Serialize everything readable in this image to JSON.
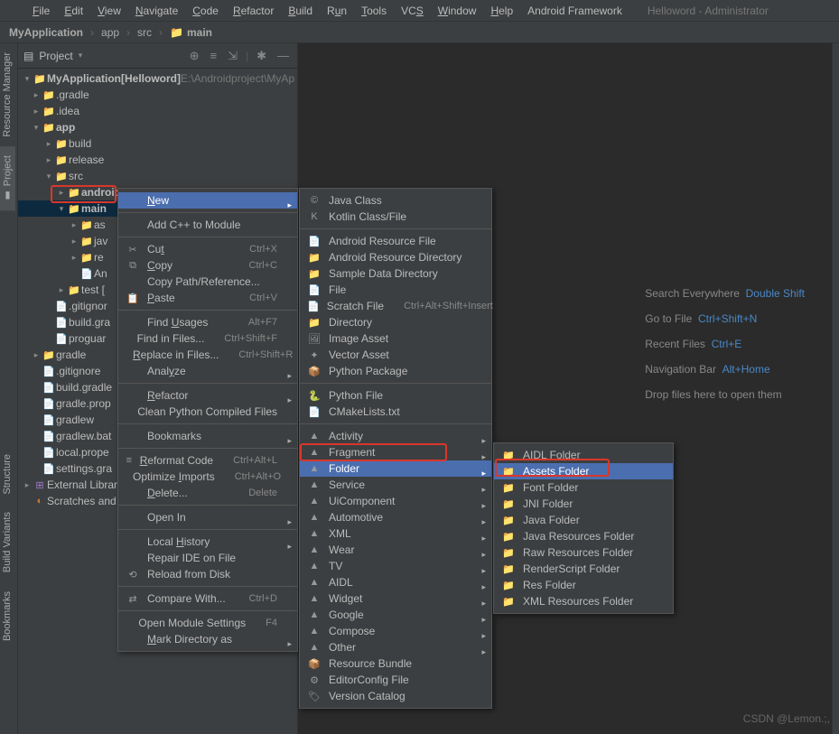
{
  "menubar": {
    "items": [
      "File",
      "Edit",
      "View",
      "Navigate",
      "Code",
      "Refactor",
      "Build",
      "Run",
      "Tools",
      "VCS",
      "Window",
      "Help",
      "Android Framework"
    ],
    "title": "Helloword - Administrator"
  },
  "crumb": [
    "MyApplication",
    "app",
    "src",
    "main"
  ],
  "leftTabs": [
    "Resource Manager",
    "Project"
  ],
  "bottomTabs": [
    "Structure",
    "Build Variants",
    "Bookmarks"
  ],
  "sidebar": {
    "title": "Project",
    "tree": [
      {
        "d": 0,
        "a": "v",
        "ic": "📁",
        "cls": "c-blue",
        "t": "MyApplication",
        "b": true,
        "extra": "[Helloword]",
        "hint": "E:\\Androidproject\\MyAp"
      },
      {
        "d": 1,
        "a": ">",
        "ic": "📁",
        "cls": "c-orange",
        "t": ".gradle"
      },
      {
        "d": 1,
        "a": ">",
        "ic": "📁",
        "cls": "c-grey",
        "t": ".idea"
      },
      {
        "d": 1,
        "a": "v",
        "ic": "📁",
        "cls": "c-teal",
        "t": "app",
        "b": true
      },
      {
        "d": 2,
        "a": ">",
        "ic": "📁",
        "cls": "c-orange",
        "t": "build"
      },
      {
        "d": 2,
        "a": ">",
        "ic": "📁",
        "cls": "c-grey",
        "t": "release"
      },
      {
        "d": 2,
        "a": "v",
        "ic": "📁",
        "cls": "c-grey",
        "t": "src"
      },
      {
        "d": 3,
        "a": ">",
        "ic": "📁",
        "cls": "c-teal",
        "t": "androidTest",
        "b": true
      },
      {
        "d": 3,
        "a": "v",
        "ic": "📁",
        "cls": "c-teal",
        "t": "main",
        "b": true,
        "sel": true
      },
      {
        "d": 4,
        "a": ">",
        "ic": "📁",
        "cls": "c-orange",
        "t": "as"
      },
      {
        "d": 4,
        "a": ">",
        "ic": "📁",
        "cls": "c-blue",
        "t": "jav"
      },
      {
        "d": 4,
        "a": ">",
        "ic": "📁",
        "cls": "c-orange",
        "t": "re"
      },
      {
        "d": 4,
        "a": "",
        "ic": "📄",
        "cls": "c-grey",
        "t": "An"
      },
      {
        "d": 3,
        "a": ">",
        "ic": "📁",
        "cls": "c-teal",
        "t": "test ["
      },
      {
        "d": 2,
        "a": "",
        "ic": "📄",
        "cls": "c-grey",
        "t": ".gitignor"
      },
      {
        "d": 2,
        "a": "",
        "ic": "📄",
        "cls": "c-teal",
        "t": "build.gra"
      },
      {
        "d": 2,
        "a": "",
        "ic": "📄",
        "cls": "c-grey",
        "t": "proguar"
      },
      {
        "d": 1,
        "a": ">",
        "ic": "📁",
        "cls": "c-grey",
        "t": "gradle"
      },
      {
        "d": 1,
        "a": "",
        "ic": "📄",
        "cls": "c-grey",
        "t": ".gitignore"
      },
      {
        "d": 1,
        "a": "",
        "ic": "📄",
        "cls": "c-teal",
        "t": "build.gradle"
      },
      {
        "d": 1,
        "a": "",
        "ic": "📄",
        "cls": "c-grey",
        "t": "gradle.prop"
      },
      {
        "d": 1,
        "a": "",
        "ic": "📄",
        "cls": "c-grey",
        "t": "gradlew"
      },
      {
        "d": 1,
        "a": "",
        "ic": "📄",
        "cls": "c-grey",
        "t": "gradlew.bat"
      },
      {
        "d": 1,
        "a": "",
        "ic": "📄",
        "cls": "c-grey",
        "t": "local.prope"
      },
      {
        "d": 1,
        "a": "",
        "ic": "📄",
        "cls": "c-teal",
        "t": "settings.gra"
      },
      {
        "d": 0,
        "a": ">",
        "ic": "⊞",
        "cls": "c-purple",
        "t": "External Librari"
      },
      {
        "d": 0,
        "a": "",
        "ic": "◐",
        "cls": "c-orange",
        "t": "Scratches and"
      }
    ]
  },
  "ctx1": [
    {
      "t": "New",
      "sel": true,
      "arr": true,
      "u": 0
    },
    "sep",
    {
      "t": "Add C++ to Module"
    },
    "sep",
    {
      "i": "✂",
      "t": "Cut",
      "sc": "Ctrl+X",
      "u": 2
    },
    {
      "i": "⧉",
      "t": "Copy",
      "sc": "Ctrl+C",
      "u": 0
    },
    {
      "t": "Copy Path/Reference..."
    },
    {
      "i": "📋",
      "t": "Paste",
      "sc": "Ctrl+V",
      "u": 0
    },
    "sep",
    {
      "t": "Find Usages",
      "sc": "Alt+F7",
      "u": 5
    },
    {
      "t": "Find in Files...",
      "sc": "Ctrl+Shift+F"
    },
    {
      "t": "Replace in Files...",
      "sc": "Ctrl+Shift+R",
      "u": 0
    },
    {
      "t": "Analyze",
      "arr": true,
      "u": 4
    },
    "sep",
    {
      "t": "Refactor",
      "arr": true,
      "u": 0
    },
    {
      "t": "Clean Python Compiled Files"
    },
    "sep",
    {
      "t": "Bookmarks",
      "arr": true
    },
    "sep",
    {
      "i": "≡",
      "t": "Reformat Code",
      "sc": "Ctrl+Alt+L",
      "u": 0
    },
    {
      "t": "Optimize Imports",
      "sc": "Ctrl+Alt+O",
      "u": 9
    },
    {
      "t": "Delete...",
      "sc": "Delete",
      "u": 0
    },
    "sep",
    {
      "t": "Open In",
      "arr": true
    },
    "sep",
    {
      "t": "Local History",
      "arr": true,
      "u": 6
    },
    {
      "t": "Repair IDE on File"
    },
    {
      "i": "⟲",
      "t": "Reload from Disk"
    },
    "sep",
    {
      "t": "Compare With...",
      "sc": "Ctrl+D",
      "i": "⇄"
    },
    "sep",
    {
      "t": "Open Module Settings",
      "sc": "F4"
    },
    {
      "t": "Mark Directory as",
      "arr": true,
      "u": 0
    }
  ],
  "ctx2": [
    {
      "i": "©",
      "cls": "c-blue",
      "t": "Java Class"
    },
    {
      "i": "K",
      "cls": "c-orange",
      "t": "Kotlin Class/File"
    },
    "sep",
    {
      "i": "📄",
      "cls": "c-grey",
      "t": "Android Resource File"
    },
    {
      "i": "📁",
      "cls": "c-grey",
      "t": "Android Resource Directory"
    },
    {
      "i": "📁",
      "cls": "c-grey",
      "t": "Sample Data Directory"
    },
    {
      "i": "📄",
      "cls": "c-grey",
      "t": "File"
    },
    {
      "i": "📄",
      "cls": "c-grey",
      "t": "Scratch File",
      "sc": "Ctrl+Alt+Shift+Insert"
    },
    {
      "i": "📁",
      "cls": "c-grey",
      "t": "Directory"
    },
    {
      "i": "🖼",
      "cls": "c-grey",
      "t": "Image Asset"
    },
    {
      "i": "✦",
      "cls": "c-grey",
      "t": "Vector Asset"
    },
    {
      "i": "📦",
      "cls": "c-blue",
      "t": "Python Package"
    },
    "sep",
    {
      "i": "🐍",
      "cls": "c-blue",
      "t": "Python File"
    },
    {
      "i": "📄",
      "cls": "c-grey",
      "t": "CMakeLists.txt"
    },
    "sep",
    {
      "i": "▲",
      "cls": "c-an",
      "t": "Activity",
      "arr": true
    },
    {
      "i": "▲",
      "cls": "c-an",
      "t": "Fragment",
      "arr": true
    },
    {
      "i": "▲",
      "cls": "c-an",
      "t": "Folder",
      "arr": true,
      "sel": true
    },
    {
      "i": "▲",
      "cls": "c-an",
      "t": "Service",
      "arr": true
    },
    {
      "i": "▲",
      "cls": "c-an",
      "t": "UiComponent",
      "arr": true
    },
    {
      "i": "▲",
      "cls": "c-an",
      "t": "Automotive",
      "arr": true
    },
    {
      "i": "▲",
      "cls": "c-an",
      "t": "XML",
      "arr": true
    },
    {
      "i": "▲",
      "cls": "c-an",
      "t": "Wear",
      "arr": true
    },
    {
      "i": "▲",
      "cls": "c-an",
      "t": "TV",
      "arr": true
    },
    {
      "i": "▲",
      "cls": "c-an",
      "t": "AIDL",
      "arr": true
    },
    {
      "i": "▲",
      "cls": "c-an",
      "t": "Widget",
      "arr": true
    },
    {
      "i": "▲",
      "cls": "c-an",
      "t": "Google",
      "arr": true
    },
    {
      "i": "▲",
      "cls": "c-an",
      "t": "Compose",
      "arr": true
    },
    {
      "i": "▲",
      "cls": "c-an",
      "t": "Other",
      "arr": true
    },
    {
      "i": "📦",
      "cls": "c-grey",
      "t": "Resource Bundle"
    },
    {
      "i": "⚙",
      "cls": "c-grey",
      "t": "EditorConfig File"
    },
    {
      "i": "🏷",
      "cls": "c-grey",
      "t": "Version Catalog"
    }
  ],
  "ctx3": [
    {
      "i": "📁",
      "t": "AIDL Folder"
    },
    {
      "i": "📁",
      "t": "Assets Folder",
      "sel": true
    },
    {
      "i": "📁",
      "t": "Font Folder"
    },
    {
      "i": "📁",
      "t": "JNI Folder"
    },
    {
      "i": "📁",
      "t": "Java Folder"
    },
    {
      "i": "📁",
      "t": "Java Resources Folder"
    },
    {
      "i": "📁",
      "t": "Raw Resources Folder"
    },
    {
      "i": "📁",
      "t": "RenderScript Folder"
    },
    {
      "i": "📁",
      "t": "Res Folder"
    },
    {
      "i": "📁",
      "t": "XML Resources Folder"
    }
  ],
  "hints": [
    {
      "t": "Search Everywhere",
      "k": "Double Shift"
    },
    {
      "t": "Go to File",
      "k": "Ctrl+Shift+N"
    },
    {
      "t": "Recent Files",
      "k": "Ctrl+E"
    },
    {
      "t": "Navigation Bar",
      "k": "Alt+Home"
    },
    {
      "t": "Drop files here to open them",
      "k": ""
    }
  ],
  "watermark": "CSDN @Lemon.;,"
}
